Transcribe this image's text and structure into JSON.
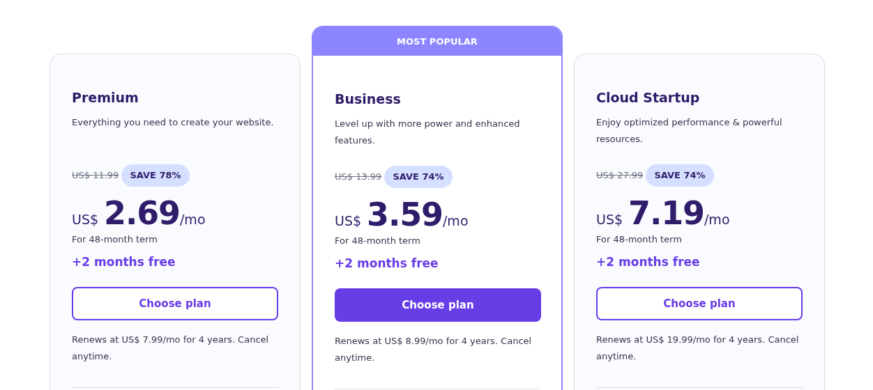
{
  "plans": [
    {
      "name": "Premium",
      "description": "Everything you need to create your website.",
      "old_price": "US$ 11.99",
      "save": "SAVE 78%",
      "currency": "US$",
      "price": "2.69",
      "period": "/mo",
      "term": "For 48-month term",
      "bonus": "+2 months free",
      "button": {
        "label": "Choose plan",
        "filled": false
      },
      "renewal": "Renews at US$ 7.99/mo for 4 years. Cancel anytime."
    },
    {
      "name": "Business",
      "badge": "MOST POPULAR",
      "description": "Level up with more power and enhanced features.",
      "old_price": "US$ 13.99",
      "save": "SAVE 74%",
      "currency": "US$",
      "price": "3.59",
      "period": "/mo",
      "term": "For 48-month term",
      "bonus": "+2 months free",
      "button": {
        "label": "Choose plan",
        "filled": true
      },
      "renewal": "Renews at US$ 8.99/mo for 4 years. Cancel anytime."
    },
    {
      "name": "Cloud Startup",
      "description": "Enjoy optimized performance & powerful resources.",
      "old_price": "US$ 27.99",
      "save": "SAVE 74%",
      "currency": "US$",
      "price": "7.19",
      "period": "/mo",
      "term": "For 48-month term",
      "bonus": "+2 months free",
      "button": {
        "label": "Choose plan",
        "filled": false
      },
      "renewal": "Renews at US$ 19.99/mo for 4 years. Cancel anytime."
    }
  ]
}
